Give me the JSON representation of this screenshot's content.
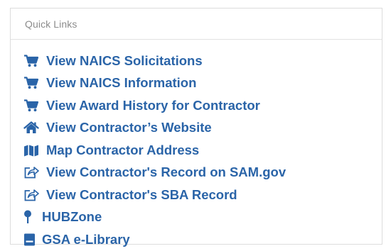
{
  "panel": {
    "title": "Quick Links"
  },
  "colors": {
    "link": "#2a64a8",
    "icon": "#2a64a8",
    "title": "#8c8c8c"
  },
  "links": [
    {
      "icon": "cart-icon",
      "label": "View NAICS Solicitations"
    },
    {
      "icon": "cart-icon",
      "label": "View NAICS Information"
    },
    {
      "icon": "cart-icon",
      "label": "View Award History for Contractor"
    },
    {
      "icon": "home-icon",
      "label": "View Contractor’s Website"
    },
    {
      "icon": "map-icon",
      "label": "Map Contractor Address"
    },
    {
      "icon": "share-icon",
      "label": "View Contractor's Record on SAM.gov"
    },
    {
      "icon": "share-icon",
      "label": "View Contractor's SBA Record"
    },
    {
      "icon": "pin-icon",
      "label": "HUBZone"
    },
    {
      "icon": "book-icon",
      "label": "GSA e-Library"
    }
  ]
}
